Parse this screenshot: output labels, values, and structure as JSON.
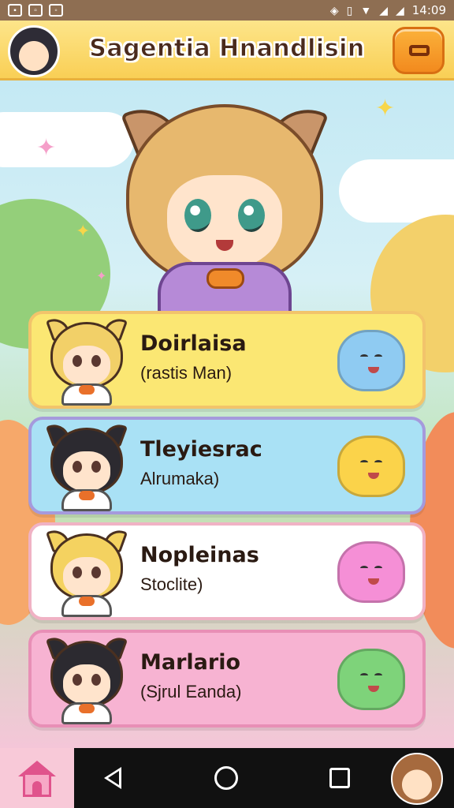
{
  "status_bar": {
    "time": "14:09",
    "left_icons": [
      "notification-icon",
      "image-icon",
      "message-icon"
    ],
    "right_icons": [
      "sync-icon",
      "battery-saver-icon",
      "wifi-icon",
      "signal-icon",
      "signal-icon"
    ]
  },
  "header": {
    "title": "Sagentia Hnandlisin",
    "menu_icon": "menu-icon"
  },
  "cards": [
    {
      "name": "Doirlaisa",
      "subtitle": "(rastis Man)",
      "theme": "yellow",
      "hair": "#f2d068",
      "pet_color": "#8fcbf2",
      "pet_icon": "blue-blob-pet-icon"
    },
    {
      "name": "Tleyiesrac",
      "subtitle": "Alrumaka)",
      "theme": "blue",
      "hair": "#2c2a30",
      "pet_color": "#fbd34a",
      "pet_icon": "yellow-blob-pet-icon"
    },
    {
      "name": "Nopleinas",
      "subtitle": "Stoclite)",
      "theme": "white",
      "hair": "#f4d260",
      "pet_color": "#f58fd6",
      "pet_icon": "pink-blob-pet-icon"
    },
    {
      "name": "Marlario",
      "subtitle": "(Sjrul Eanda)",
      "theme": "pink",
      "hair": "#2c2a30",
      "pet_color": "#7ed37a",
      "pet_icon": "green-blob-pet-icon"
    }
  ],
  "nav": {
    "home_icon": "home-icon",
    "back_icon": "back-icon",
    "home_circle_icon": "home-circle-icon",
    "recents_icon": "recents-icon",
    "profile_icon": "profile-avatar-icon"
  },
  "colors": {
    "header_bg": "#f9cf55",
    "menu_button": "#f28a1e",
    "card_yellow": "#fbe773",
    "card_blue": "#a9e1f5",
    "card_white": "#ffffff",
    "card_pink": "#f7b3d2"
  }
}
